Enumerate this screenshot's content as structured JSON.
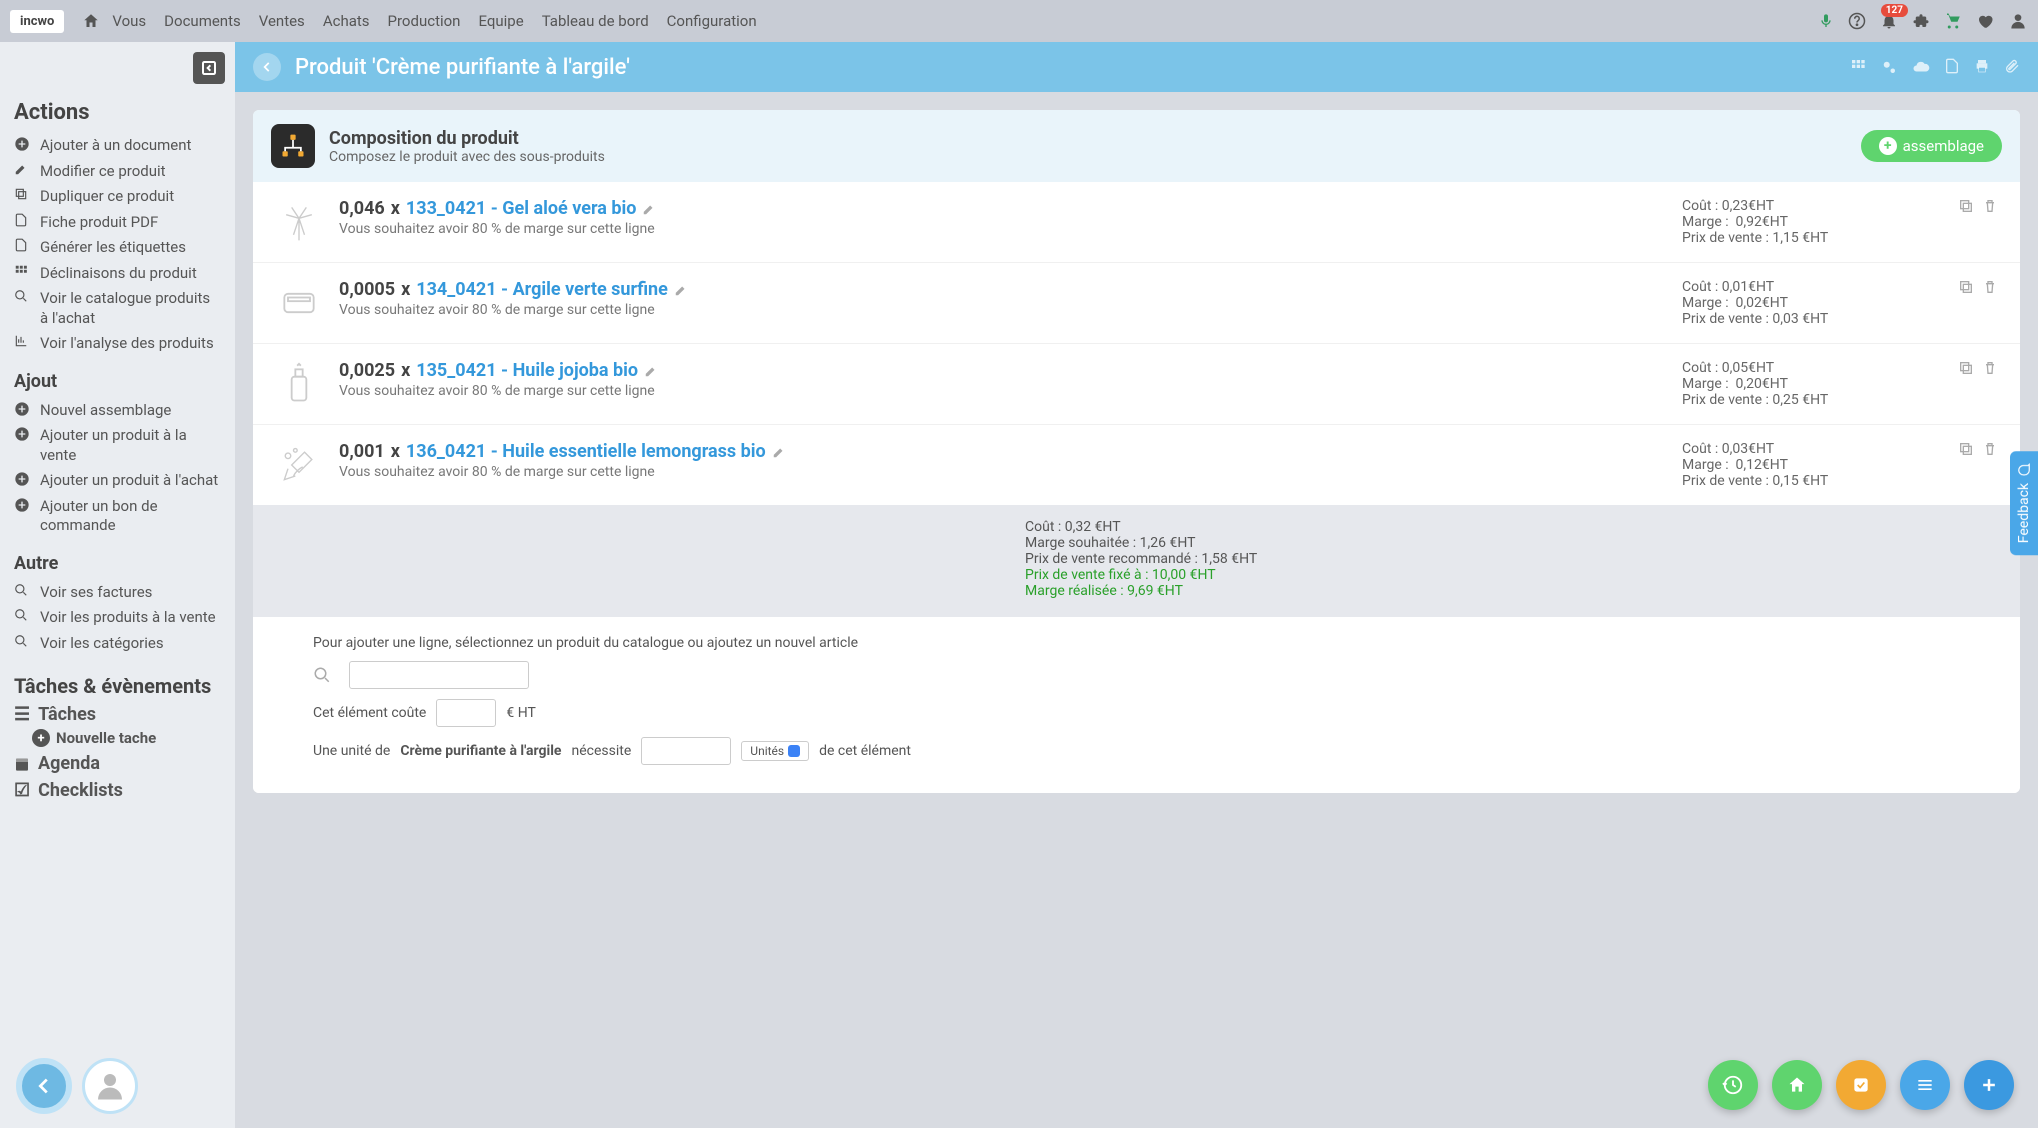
{
  "brand": "incwo",
  "nav": [
    "Vous",
    "Documents",
    "Ventes",
    "Achats",
    "Production",
    "Equipe",
    "Tableau de bord",
    "Configuration"
  ],
  "notif_count": "127",
  "page_title": "Produit 'Crème purifiante à l'argile'",
  "sidebar": {
    "actions_title": "Actions",
    "actions": [
      {
        "icon": "plus-circle",
        "label": "Ajouter à un document"
      },
      {
        "icon": "pencil",
        "label": "Modifier ce produit"
      },
      {
        "icon": "copy",
        "label": "Dupliquer ce produit"
      },
      {
        "icon": "pdf",
        "label": "Fiche produit PDF"
      },
      {
        "icon": "pdf",
        "label": "Générer les étiquettes"
      },
      {
        "icon": "grid",
        "label": "Déclinaisons du produit"
      },
      {
        "icon": "search",
        "label": "Voir le catalogue produits à l'achat"
      },
      {
        "icon": "chart",
        "label": "Voir l'analyse des produits"
      }
    ],
    "ajout_title": "Ajout",
    "ajout": [
      {
        "icon": "plus-circle",
        "label": "Nouvel assemblage"
      },
      {
        "icon": "plus-circle",
        "label": "Ajouter un produit à la vente"
      },
      {
        "icon": "plus-circle",
        "label": "Ajouter un produit à l'achat"
      },
      {
        "icon": "plus-circle",
        "label": "Ajouter un bon de commande"
      }
    ],
    "autre_title": "Autre",
    "autre": [
      {
        "icon": "search",
        "label": "Voir ses factures"
      },
      {
        "icon": "search",
        "label": "Voir les produits à la vente"
      },
      {
        "icon": "search",
        "label": "Voir les catégories"
      }
    ],
    "tasks_title": "Tâches & évènements",
    "tasks": "Tâches",
    "new_task": "Nouvelle tache",
    "agenda": "Agenda",
    "checklist": "Checklists"
  },
  "panel": {
    "title": "Composition du produit",
    "subtitle": "Composez le produit avec des sous-produits",
    "btn": "assemblage"
  },
  "components": [
    {
      "qty": "0,046",
      "sku": "133_0421",
      "name": "Gel aloé vera bio",
      "sub": "Vous souhaitez avoir 80 % de marge sur cette ligne",
      "cost": "0,23€HT",
      "margin": "0,92€HT",
      "price": "1,15 €HT"
    },
    {
      "qty": "0,0005",
      "sku": "134_0421",
      "name": "Argile verte surfine",
      "sub": "Vous souhaitez avoir 80 % de marge sur cette ligne",
      "cost": "0,01€HT",
      "margin": "0,02€HT",
      "price": "0,03 €HT"
    },
    {
      "qty": "0,0025",
      "sku": "135_0421",
      "name": "Huile jojoba bio",
      "sub": "Vous souhaitez avoir 80 % de marge sur cette ligne",
      "cost": "0,05€HT",
      "margin": "0,20€HT",
      "price": "0,25 €HT"
    },
    {
      "qty": "0,001",
      "sku": "136_0421",
      "name": "Huile essentielle lemongrass bio",
      "sub": "Vous souhaitez avoir 80 % de marge sur cette ligne",
      "cost": "0,03€HT",
      "margin": "0,12€HT",
      "price": "0,15 €HT"
    }
  ],
  "labels": {
    "cost": "Coût :",
    "margin": "Marge :",
    "price": "Prix de vente :",
    "x": " x "
  },
  "totals": {
    "cost": "Coût : 0,32 €HT",
    "margin": "Marge souhaitée : 1,26 €HT",
    "reco": "Prix de vente recommandé : 1,58 €HT",
    "fixed": "Prix de vente fixé à : 10,00 €HT",
    "realized": "Marge réalisée : 9,69 €HT"
  },
  "form": {
    "help": "Pour ajouter une ligne, sélectionnez un produit du catalogue ou ajoutez un nouvel article",
    "cost_label": "Cet élément coûte",
    "cost_suffix": "€ HT",
    "unit_prefix": "Une unité de",
    "unit_product": "Crème purifiante à l'argile",
    "unit_mid": "nécessite",
    "units_badge": "Unités",
    "unit_suffix": "de cet élément"
  },
  "feedback": "Feedback"
}
